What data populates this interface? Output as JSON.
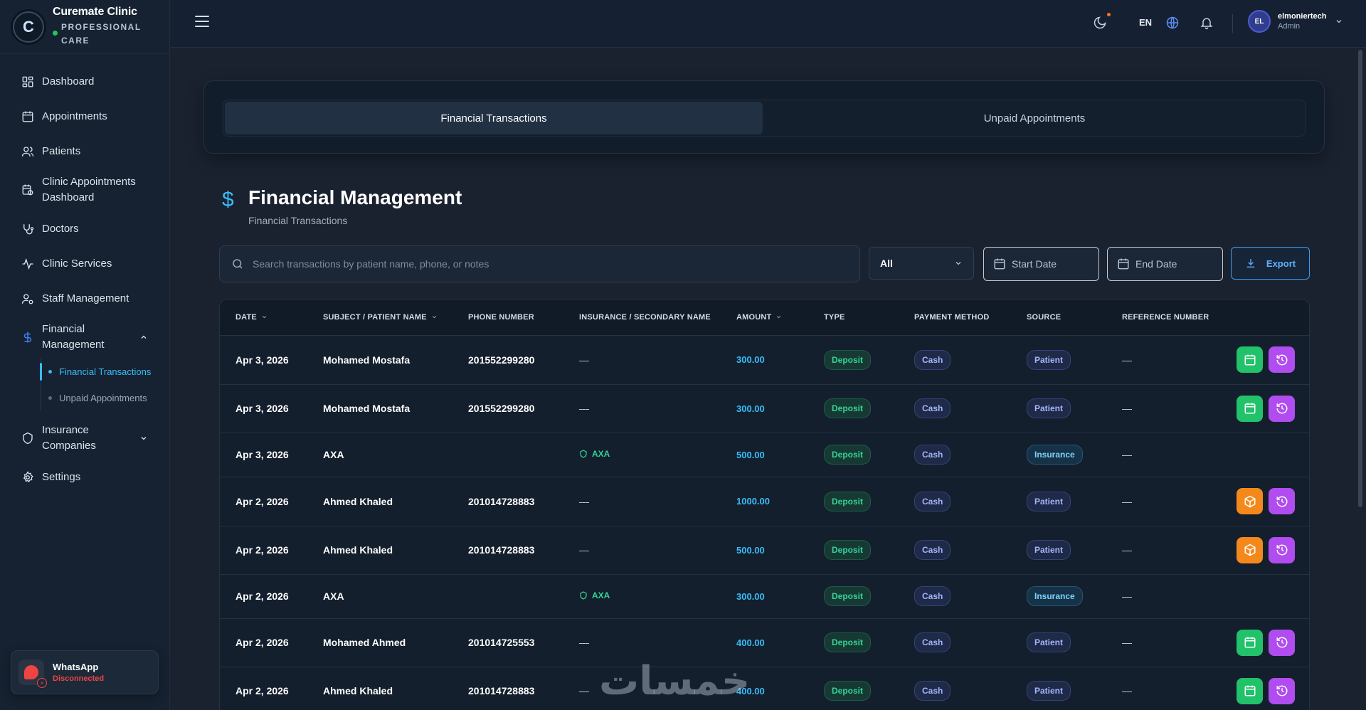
{
  "brand": {
    "name": "Curemate Clinic",
    "tagline": "PROFESSIONAL CARE",
    "logo_letter": "C"
  },
  "sidebar": {
    "items": [
      {
        "label": "Dashboard",
        "icon": "grid-icon"
      },
      {
        "label": "Appointments",
        "icon": "calendar-icon"
      },
      {
        "label": "Patients",
        "icon": "users-icon"
      },
      {
        "label": "Clinic Appointments Dashboard",
        "icon": "calendar-clock-icon"
      },
      {
        "label": "Doctors",
        "icon": "stethoscope-icon"
      },
      {
        "label": "Clinic Services",
        "icon": "activity-icon"
      },
      {
        "label": "Staff Management",
        "icon": "user-cog-icon"
      },
      {
        "label": "Financial Management",
        "icon": "dollar-icon",
        "expanded": true
      },
      {
        "label": "Insurance Companies",
        "icon": "shield-icon",
        "expanded": false
      },
      {
        "label": "Settings",
        "icon": "gear-icon"
      }
    ],
    "financial_sub": [
      {
        "label": "Financial Transactions",
        "active": true
      },
      {
        "label": "Unpaid Appointments",
        "active": false
      }
    ]
  },
  "whatsapp": {
    "title": "WhatsApp",
    "status": "Disconnected"
  },
  "topbar": {
    "language": "EN",
    "user": {
      "initials": "EL",
      "name": "elmoniertech",
      "role": "Admin"
    }
  },
  "tabs": [
    {
      "label": "Financial Transactions",
      "active": true
    },
    {
      "label": "Unpaid Appointments",
      "active": false
    }
  ],
  "page": {
    "icon": "$",
    "title": "Financial Management",
    "subtitle": "Financial Transactions"
  },
  "filters": {
    "search_placeholder": "Search transactions by patient name, phone, or notes",
    "type_selected": "All",
    "start_date_placeholder": "Start Date",
    "end_date_placeholder": "End Date",
    "export_label": "Export"
  },
  "table": {
    "headers": [
      "DATE",
      "SUBJECT / PATIENT NAME",
      "PHONE NUMBER",
      "INSURANCE / SECONDARY NAME",
      "AMOUNT",
      "TYPE",
      "PAYMENT METHOD",
      "SOURCE",
      "REFERENCE NUMBER"
    ],
    "rows": [
      {
        "date": "Apr 3, 2026",
        "name": "Mohamed Mostafa",
        "phone": "201552299280",
        "insurance": "—",
        "amount": "300.00",
        "type": "Deposit",
        "method": "Cash",
        "source": "Patient",
        "reference": "—",
        "actions": [
          "green-calendar",
          "purple-history"
        ]
      },
      {
        "date": "Apr 3, 2026",
        "name": "Mohamed Mostafa",
        "phone": "201552299280",
        "insurance": "—",
        "amount": "300.00",
        "type": "Deposit",
        "method": "Cash",
        "source": "Patient",
        "reference": "—",
        "actions": [
          "green-calendar",
          "purple-history"
        ]
      },
      {
        "date": "Apr 3, 2026",
        "name": "AXA",
        "phone": "",
        "insurance": "AXA",
        "amount": "500.00",
        "type": "Deposit",
        "method": "Cash",
        "source": "Insurance",
        "reference": "—",
        "actions": []
      },
      {
        "date": "Apr 2, 2026",
        "name": "Ahmed Khaled",
        "phone": "201014728883",
        "insurance": "—",
        "amount": "1000.00",
        "type": "Deposit",
        "method": "Cash",
        "source": "Patient",
        "reference": "—",
        "actions": [
          "orange-package",
          "purple-history"
        ]
      },
      {
        "date": "Apr 2, 2026",
        "name": "Ahmed Khaled",
        "phone": "201014728883",
        "insurance": "—",
        "amount": "500.00",
        "type": "Deposit",
        "method": "Cash",
        "source": "Patient",
        "reference": "—",
        "actions": [
          "orange-package",
          "purple-history"
        ]
      },
      {
        "date": "Apr 2, 2026",
        "name": "AXA",
        "phone": "",
        "insurance": "AXA",
        "amount": "300.00",
        "type": "Deposit",
        "method": "Cash",
        "source": "Insurance",
        "reference": "—",
        "actions": []
      },
      {
        "date": "Apr 2, 2026",
        "name": "Mohamed Ahmed",
        "phone": "201014725553",
        "insurance": "—",
        "amount": "400.00",
        "type": "Deposit",
        "method": "Cash",
        "source": "Patient",
        "reference": "—",
        "actions": [
          "green-calendar",
          "purple-history"
        ]
      },
      {
        "date": "Apr 2, 2026",
        "name": "Ahmed Khaled",
        "phone": "201014728883",
        "insurance": "—",
        "amount": "400.00",
        "type": "Deposit",
        "method": "Cash",
        "source": "Patient",
        "reference": "—",
        "actions": [
          "green-calendar",
          "purple-history"
        ]
      }
    ]
  },
  "watermark": "خمسات",
  "colors": {
    "background": "#1a2230",
    "sidebar": "#162231",
    "accent": "#38bdf8",
    "deposit": "#34d399",
    "green_action": "#21c26a",
    "orange_action": "#f5881b",
    "purple_action": "#b14cf0",
    "disconnected": "#ef4444"
  }
}
